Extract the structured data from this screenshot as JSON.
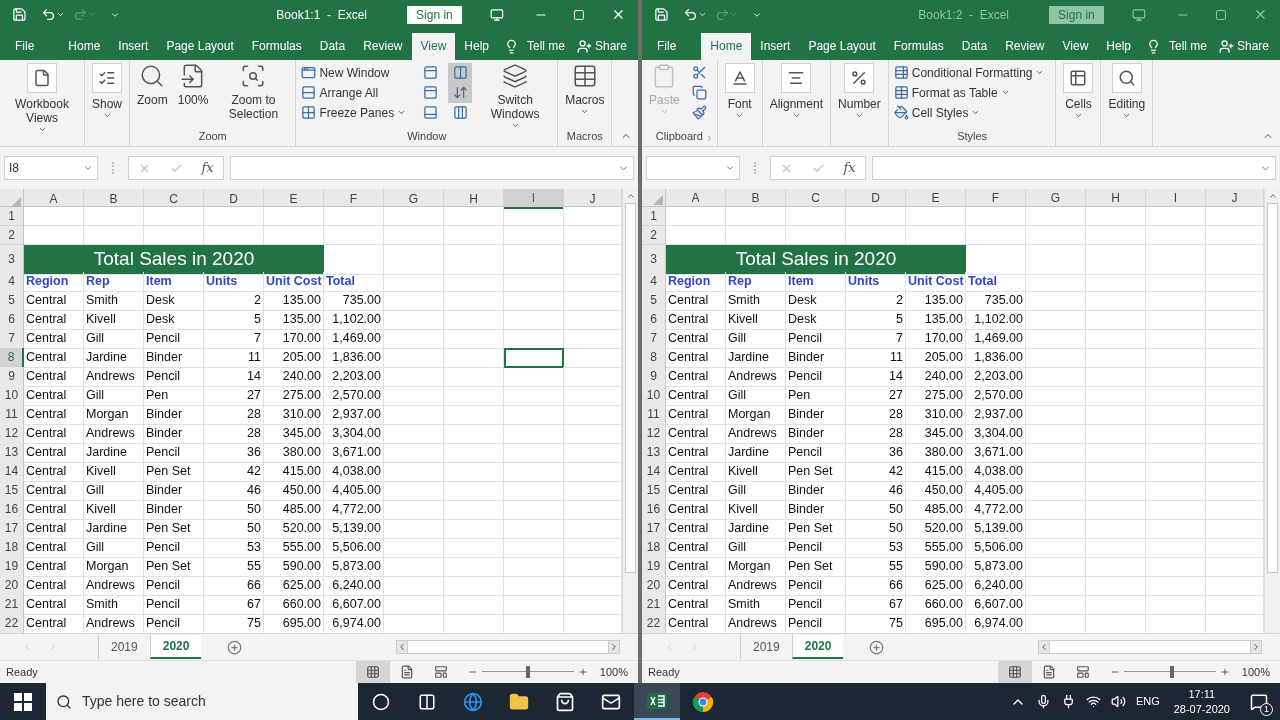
{
  "windows": [
    {
      "title": "Book1:1  -  Excel",
      "active": true,
      "sign_in": "Sign in",
      "tabs": [
        {
          "label": "File",
          "selected": false
        },
        {
          "label": "Home",
          "selected": false
        },
        {
          "label": "Insert",
          "selected": false
        },
        {
          "label": "Page Layout",
          "selected": false
        },
        {
          "label": "Formulas",
          "selected": false
        },
        {
          "label": "Data",
          "selected": false
        },
        {
          "label": "Review",
          "selected": false
        },
        {
          "label": "View",
          "selected": true
        },
        {
          "label": "Help",
          "selected": false
        }
      ],
      "tell_me": "Tell me",
      "share": "Share",
      "ribbon": {
        "kind": "view",
        "groups": [
          {
            "items": [
              {
                "kind": "collapsed",
                "label": "Workbook Views",
                "dropdown": true,
                "disabled": false
              }
            ]
          },
          {
            "items": [
              {
                "kind": "collapsed",
                "label": "Show",
                "dropdown": true,
                "disabled": false
              }
            ]
          },
          {
            "label": "Zoom",
            "items": [
              {
                "kind": "large",
                "label": "Zoom",
                "dropdown": false,
                "disabled": false
              },
              {
                "kind": "large",
                "label": "100%",
                "dropdown": false,
                "disabled": false
              },
              {
                "kind": "large",
                "label": "Zoom to Selection",
                "dropdown": false,
                "disabled": false
              }
            ]
          },
          {
            "label": "Window",
            "items": [
              {
                "kind": "stack",
                "entries": [
                  {
                    "label": "New Window",
                    "dropdown": false
                  },
                  {
                    "label": "Arrange All",
                    "dropdown": false
                  },
                  {
                    "label": "Freeze Panes",
                    "dropdown": true
                  }
                ]
              },
              {
                "kind": "icons",
                "entries": [
                  {
                    "selected": false
                  },
                  {
                    "selected": false
                  },
                  {
                    "selected": false
                  }
                ]
              },
              {
                "kind": "icons",
                "entries": [
                  {
                    "selected": true
                  },
                  {
                    "selected": true
                  },
                  {
                    "selected": false
                  }
                ]
              },
              {
                "kind": "large",
                "label": "Switch Windows",
                "dropdown": true,
                "disabled": false
              }
            ]
          },
          {
            "label": "Macros",
            "items": [
              {
                "kind": "large",
                "label": "Macros",
                "dropdown": true,
                "disabled": false
              }
            ]
          }
        ]
      },
      "name_box": "I8",
      "formula_button": "fx",
      "columns": [
        {
          "label": "A",
          "selected": false
        },
        {
          "label": "B",
          "selected": false
        },
        {
          "label": "C",
          "selected": false
        },
        {
          "label": "D",
          "selected": false
        },
        {
          "label": "E",
          "selected": false
        },
        {
          "label": "F",
          "selected": false
        },
        {
          "label": "G",
          "selected": false
        },
        {
          "label": "H",
          "selected": false
        },
        {
          "label": "I",
          "selected": true
        },
        {
          "label": "J",
          "selected": false
        }
      ],
      "rows": [
        {
          "header": "1",
          "kind": "blank",
          "selected": false
        },
        {
          "header": "2",
          "kind": "blank",
          "selected": false
        },
        {
          "header": "3",
          "kind": "title",
          "selected": false,
          "text": "Total Sales in 2020"
        },
        {
          "header": "4",
          "kind": "header",
          "selected": false,
          "cells": [
            "Region",
            "Rep",
            "Item",
            "Units",
            "Unit Cost",
            "Total"
          ]
        },
        {
          "header": "5",
          "kind": "data",
          "selected": false,
          "cells": [
            "Central",
            "Smith",
            "Desk",
            "2",
            "135.00",
            "735.00"
          ]
        },
        {
          "header": "6",
          "kind": "data",
          "selected": false,
          "cells": [
            "Central",
            "Kivell",
            "Desk",
            "5",
            "135.00",
            "1,102.00"
          ]
        },
        {
          "header": "7",
          "kind": "data",
          "selected": false,
          "cells": [
            "Central",
            "Gill",
            "Pencil",
            "7",
            "170.00",
            "1,469.00"
          ]
        },
        {
          "header": "8",
          "kind": "data",
          "selected": true,
          "cells": [
            "Central",
            "Jardine",
            "Binder",
            "11",
            "205.00",
            "1,836.00"
          ]
        },
        {
          "header": "9",
          "kind": "data",
          "selected": false,
          "cells": [
            "Central",
            "Andrews",
            "Pencil",
            "14",
            "240.00",
            "2,203.00"
          ]
        },
        {
          "header": "10",
          "kind": "data",
          "selected": false,
          "cells": [
            "Central",
            "Gill",
            "Pen",
            "27",
            "275.00",
            "2,570.00"
          ]
        },
        {
          "header": "11",
          "kind": "data",
          "selected": false,
          "cells": [
            "Central",
            "Morgan",
            "Binder",
            "28",
            "310.00",
            "2,937.00"
          ]
        },
        {
          "header": "12",
          "kind": "data",
          "selected": false,
          "cells": [
            "Central",
            "Andrews",
            "Binder",
            "28",
            "345.00",
            "3,304.00"
          ]
        },
        {
          "header": "13",
          "kind": "data",
          "selected": false,
          "cells": [
            "Central",
            "Jardine",
            "Pencil",
            "36",
            "380.00",
            "3,671.00"
          ]
        },
        {
          "header": "14",
          "kind": "data",
          "selected": false,
          "cells": [
            "Central",
            "Kivell",
            "Pen Set",
            "42",
            "415.00",
            "4,038.00"
          ]
        },
        {
          "header": "15",
          "kind": "data",
          "selected": false,
          "cells": [
            "Central",
            "Gill",
            "Binder",
            "46",
            "450.00",
            "4,405.00"
          ]
        },
        {
          "header": "16",
          "kind": "data",
          "selected": false,
          "cells": [
            "Central",
            "Kivell",
            "Binder",
            "50",
            "485.00",
            "4,772.00"
          ]
        },
        {
          "header": "17",
          "kind": "data",
          "selected": false,
          "cells": [
            "Central",
            "Jardine",
            "Pen Set",
            "50",
            "520.00",
            "5,139.00"
          ]
        },
        {
          "header": "18",
          "kind": "data",
          "selected": false,
          "cells": [
            "Central",
            "Gill",
            "Pencil",
            "53",
            "555.00",
            "5,506.00"
          ]
        },
        {
          "header": "19",
          "kind": "data",
          "selected": false,
          "cells": [
            "Central",
            "Morgan",
            "Pen Set",
            "55",
            "590.00",
            "5,873.00"
          ]
        },
        {
          "header": "20",
          "kind": "data",
          "selected": false,
          "cells": [
            "Central",
            "Andrews",
            "Pencil",
            "66",
            "625.00",
            "6,240.00"
          ]
        },
        {
          "header": "21",
          "kind": "data",
          "selected": false,
          "cells": [
            "Central",
            "Smith",
            "Pencil",
            "67",
            "660.00",
            "6,607.00"
          ]
        },
        {
          "header": "22",
          "kind": "data",
          "selected": false,
          "cells": [
            "Central",
            "Andrews",
            "Pencil",
            "75",
            "695.00",
            "6,974.00"
          ]
        }
      ],
      "sheet_tabs": [
        {
          "label": "2019",
          "selected": false
        },
        {
          "label": "2020",
          "selected": true
        }
      ],
      "status": "Ready",
      "views": [
        {
          "selected": true
        },
        {
          "selected": false
        },
        {
          "selected": false
        }
      ],
      "zoom": {
        "level": 0.5,
        "reading": "100%"
      }
    },
    {
      "title": "Book1:2  -  Excel",
      "active": false,
      "sign_in": "Sign in",
      "tabs": [
        {
          "label": "File",
          "selected": false
        },
        {
          "label": "Home",
          "selected": true
        },
        {
          "label": "Insert",
          "selected": false
        },
        {
          "label": "Page Layout",
          "selected": false
        },
        {
          "label": "Formulas",
          "selected": false
        },
        {
          "label": "Data",
          "selected": false
        },
        {
          "label": "Review",
          "selected": false
        },
        {
          "label": "View",
          "selected": false
        },
        {
          "label": "Help",
          "selected": false
        }
      ],
      "tell_me": "Tell me",
      "share": "Share",
      "ribbon": {
        "kind": "home",
        "groups": [
          {
            "label": "Clipboard",
            "launcher": true,
            "items": [
              {
                "kind": "large",
                "label": "Paste",
                "dropdown": true,
                "disabled": true
              },
              {
                "kind": "icons",
                "entries": [
                  {
                    "selected": false
                  },
                  {
                    "selected": false
                  },
                  {
                    "selected": false
                  }
                ]
              }
            ]
          },
          {
            "items": [
              {
                "kind": "collapsed",
                "label": "Font",
                "dropdown": true,
                "disabled": false
              }
            ]
          },
          {
            "items": [
              {
                "kind": "collapsed",
                "label": "Alignment",
                "dropdown": true,
                "disabled": false
              }
            ]
          },
          {
            "items": [
              {
                "kind": "collapsed",
                "label": "Number",
                "dropdown": true,
                "disabled": false
              }
            ]
          },
          {
            "label": "Styles",
            "items": [
              {
                "kind": "stack",
                "entries": [
                  {
                    "label": "Conditional Formatting",
                    "dropdown": true
                  },
                  {
                    "label": "Format as Table",
                    "dropdown": true
                  },
                  {
                    "label": "Cell Styles",
                    "dropdown": true
                  }
                ]
              }
            ]
          },
          {
            "items": [
              {
                "kind": "collapsed",
                "label": "Cells",
                "dropdown": true,
                "disabled": false
              }
            ]
          },
          {
            "items": [
              {
                "kind": "collapsed",
                "label": "Editing",
                "dropdown": true,
                "disabled": false
              }
            ]
          }
        ]
      },
      "formula_button": "fx",
      "columns": [
        {
          "label": "A",
          "selected": false
        },
        {
          "label": "B",
          "selected": false
        },
        {
          "label": "C",
          "selected": false
        },
        {
          "label": "D",
          "selected": false
        },
        {
          "label": "E",
          "selected": false
        },
        {
          "label": "F",
          "selected": false
        },
        {
          "label": "G",
          "selected": false
        },
        {
          "label": "H",
          "selected": false
        },
        {
          "label": "I",
          "selected": false
        },
        {
          "label": "J",
          "selected": false
        }
      ],
      "rows": [
        {
          "header": "1",
          "kind": "blank",
          "selected": false
        },
        {
          "header": "2",
          "kind": "blank",
          "selected": false
        },
        {
          "header": "3",
          "kind": "title",
          "selected": false,
          "text": "Total Sales in 2020"
        },
        {
          "header": "4",
          "kind": "header",
          "selected": false,
          "cells": [
            "Region",
            "Rep",
            "Item",
            "Units",
            "Unit Cost",
            "Total"
          ]
        },
        {
          "header": "5",
          "kind": "data",
          "selected": false,
          "cells": [
            "Central",
            "Smith",
            "Desk",
            "2",
            "135.00",
            "735.00"
          ]
        },
        {
          "header": "6",
          "kind": "data",
          "selected": false,
          "cells": [
            "Central",
            "Kivell",
            "Desk",
            "5",
            "135.00",
            "1,102.00"
          ]
        },
        {
          "header": "7",
          "kind": "data",
          "selected": false,
          "cells": [
            "Central",
            "Gill",
            "Pencil",
            "7",
            "170.00",
            "1,469.00"
          ]
        },
        {
          "header": "8",
          "kind": "data",
          "selected": false,
          "cells": [
            "Central",
            "Jardine",
            "Binder",
            "11",
            "205.00",
            "1,836.00"
          ]
        },
        {
          "header": "9",
          "kind": "data",
          "selected": false,
          "cells": [
            "Central",
            "Andrews",
            "Pencil",
            "14",
            "240.00",
            "2,203.00"
          ]
        },
        {
          "header": "10",
          "kind": "data",
          "selected": false,
          "cells": [
            "Central",
            "Gill",
            "Pen",
            "27",
            "275.00",
            "2,570.00"
          ]
        },
        {
          "header": "11",
          "kind": "data",
          "selected": false,
          "cells": [
            "Central",
            "Morgan",
            "Binder",
            "28",
            "310.00",
            "2,937.00"
          ]
        },
        {
          "header": "12",
          "kind": "data",
          "selected": false,
          "cells": [
            "Central",
            "Andrews",
            "Binder",
            "28",
            "345.00",
            "3,304.00"
          ]
        },
        {
          "header": "13",
          "kind": "data",
          "selected": false,
          "cells": [
            "Central",
            "Jardine",
            "Pencil",
            "36",
            "380.00",
            "3,671.00"
          ]
        },
        {
          "header": "14",
          "kind": "data",
          "selected": false,
          "cells": [
            "Central",
            "Kivell",
            "Pen Set",
            "42",
            "415.00",
            "4,038.00"
          ]
        },
        {
          "header": "15",
          "kind": "data",
          "selected": false,
          "cells": [
            "Central",
            "Gill",
            "Binder",
            "46",
            "450.00",
            "4,405.00"
          ]
        },
        {
          "header": "16",
          "kind": "data",
          "selected": false,
          "cells": [
            "Central",
            "Kivell",
            "Binder",
            "50",
            "485.00",
            "4,772.00"
          ]
        },
        {
          "header": "17",
          "kind": "data",
          "selected": false,
          "cells": [
            "Central",
            "Jardine",
            "Pen Set",
            "50",
            "520.00",
            "5,139.00"
          ]
        },
        {
          "header": "18",
          "kind": "data",
          "selected": false,
          "cells": [
            "Central",
            "Gill",
            "Pencil",
            "53",
            "555.00",
            "5,506.00"
          ]
        },
        {
          "header": "19",
          "kind": "data",
          "selected": false,
          "cells": [
            "Central",
            "Morgan",
            "Pen Set",
            "55",
            "590.00",
            "5,873.00"
          ]
        },
        {
          "header": "20",
          "kind": "data",
          "selected": false,
          "cells": [
            "Central",
            "Andrews",
            "Pencil",
            "66",
            "625.00",
            "6,240.00"
          ]
        },
        {
          "header": "21",
          "kind": "data",
          "selected": false,
          "cells": [
            "Central",
            "Smith",
            "Pencil",
            "67",
            "660.00",
            "6,607.00"
          ]
        },
        {
          "header": "22",
          "kind": "data",
          "selected": false,
          "cells": [
            "Central",
            "Andrews",
            "Pencil",
            "75",
            "695.00",
            "6,974.00"
          ]
        }
      ],
      "sheet_tabs": [
        {
          "label": "2019",
          "selected": false
        },
        {
          "label": "2020",
          "selected": true
        }
      ],
      "status": "Ready",
      "views": [
        {
          "selected": true
        },
        {
          "selected": false
        },
        {
          "selected": false
        }
      ],
      "zoom": {
        "level": 0.52,
        "reading": "100%"
      }
    }
  ],
  "taskbar": {
    "search_placeholder": "Type here to search",
    "apps": [
      {
        "selected": false
      },
      {
        "selected": false
      },
      {
        "selected": false
      },
      {
        "selected": false
      },
      {
        "selected": false
      },
      {
        "selected": false
      },
      {
        "selected": true
      },
      {
        "selected": false
      }
    ],
    "language": "ENG",
    "time": "17:11",
    "date": "28-07-2020",
    "notifications": "1"
  }
}
